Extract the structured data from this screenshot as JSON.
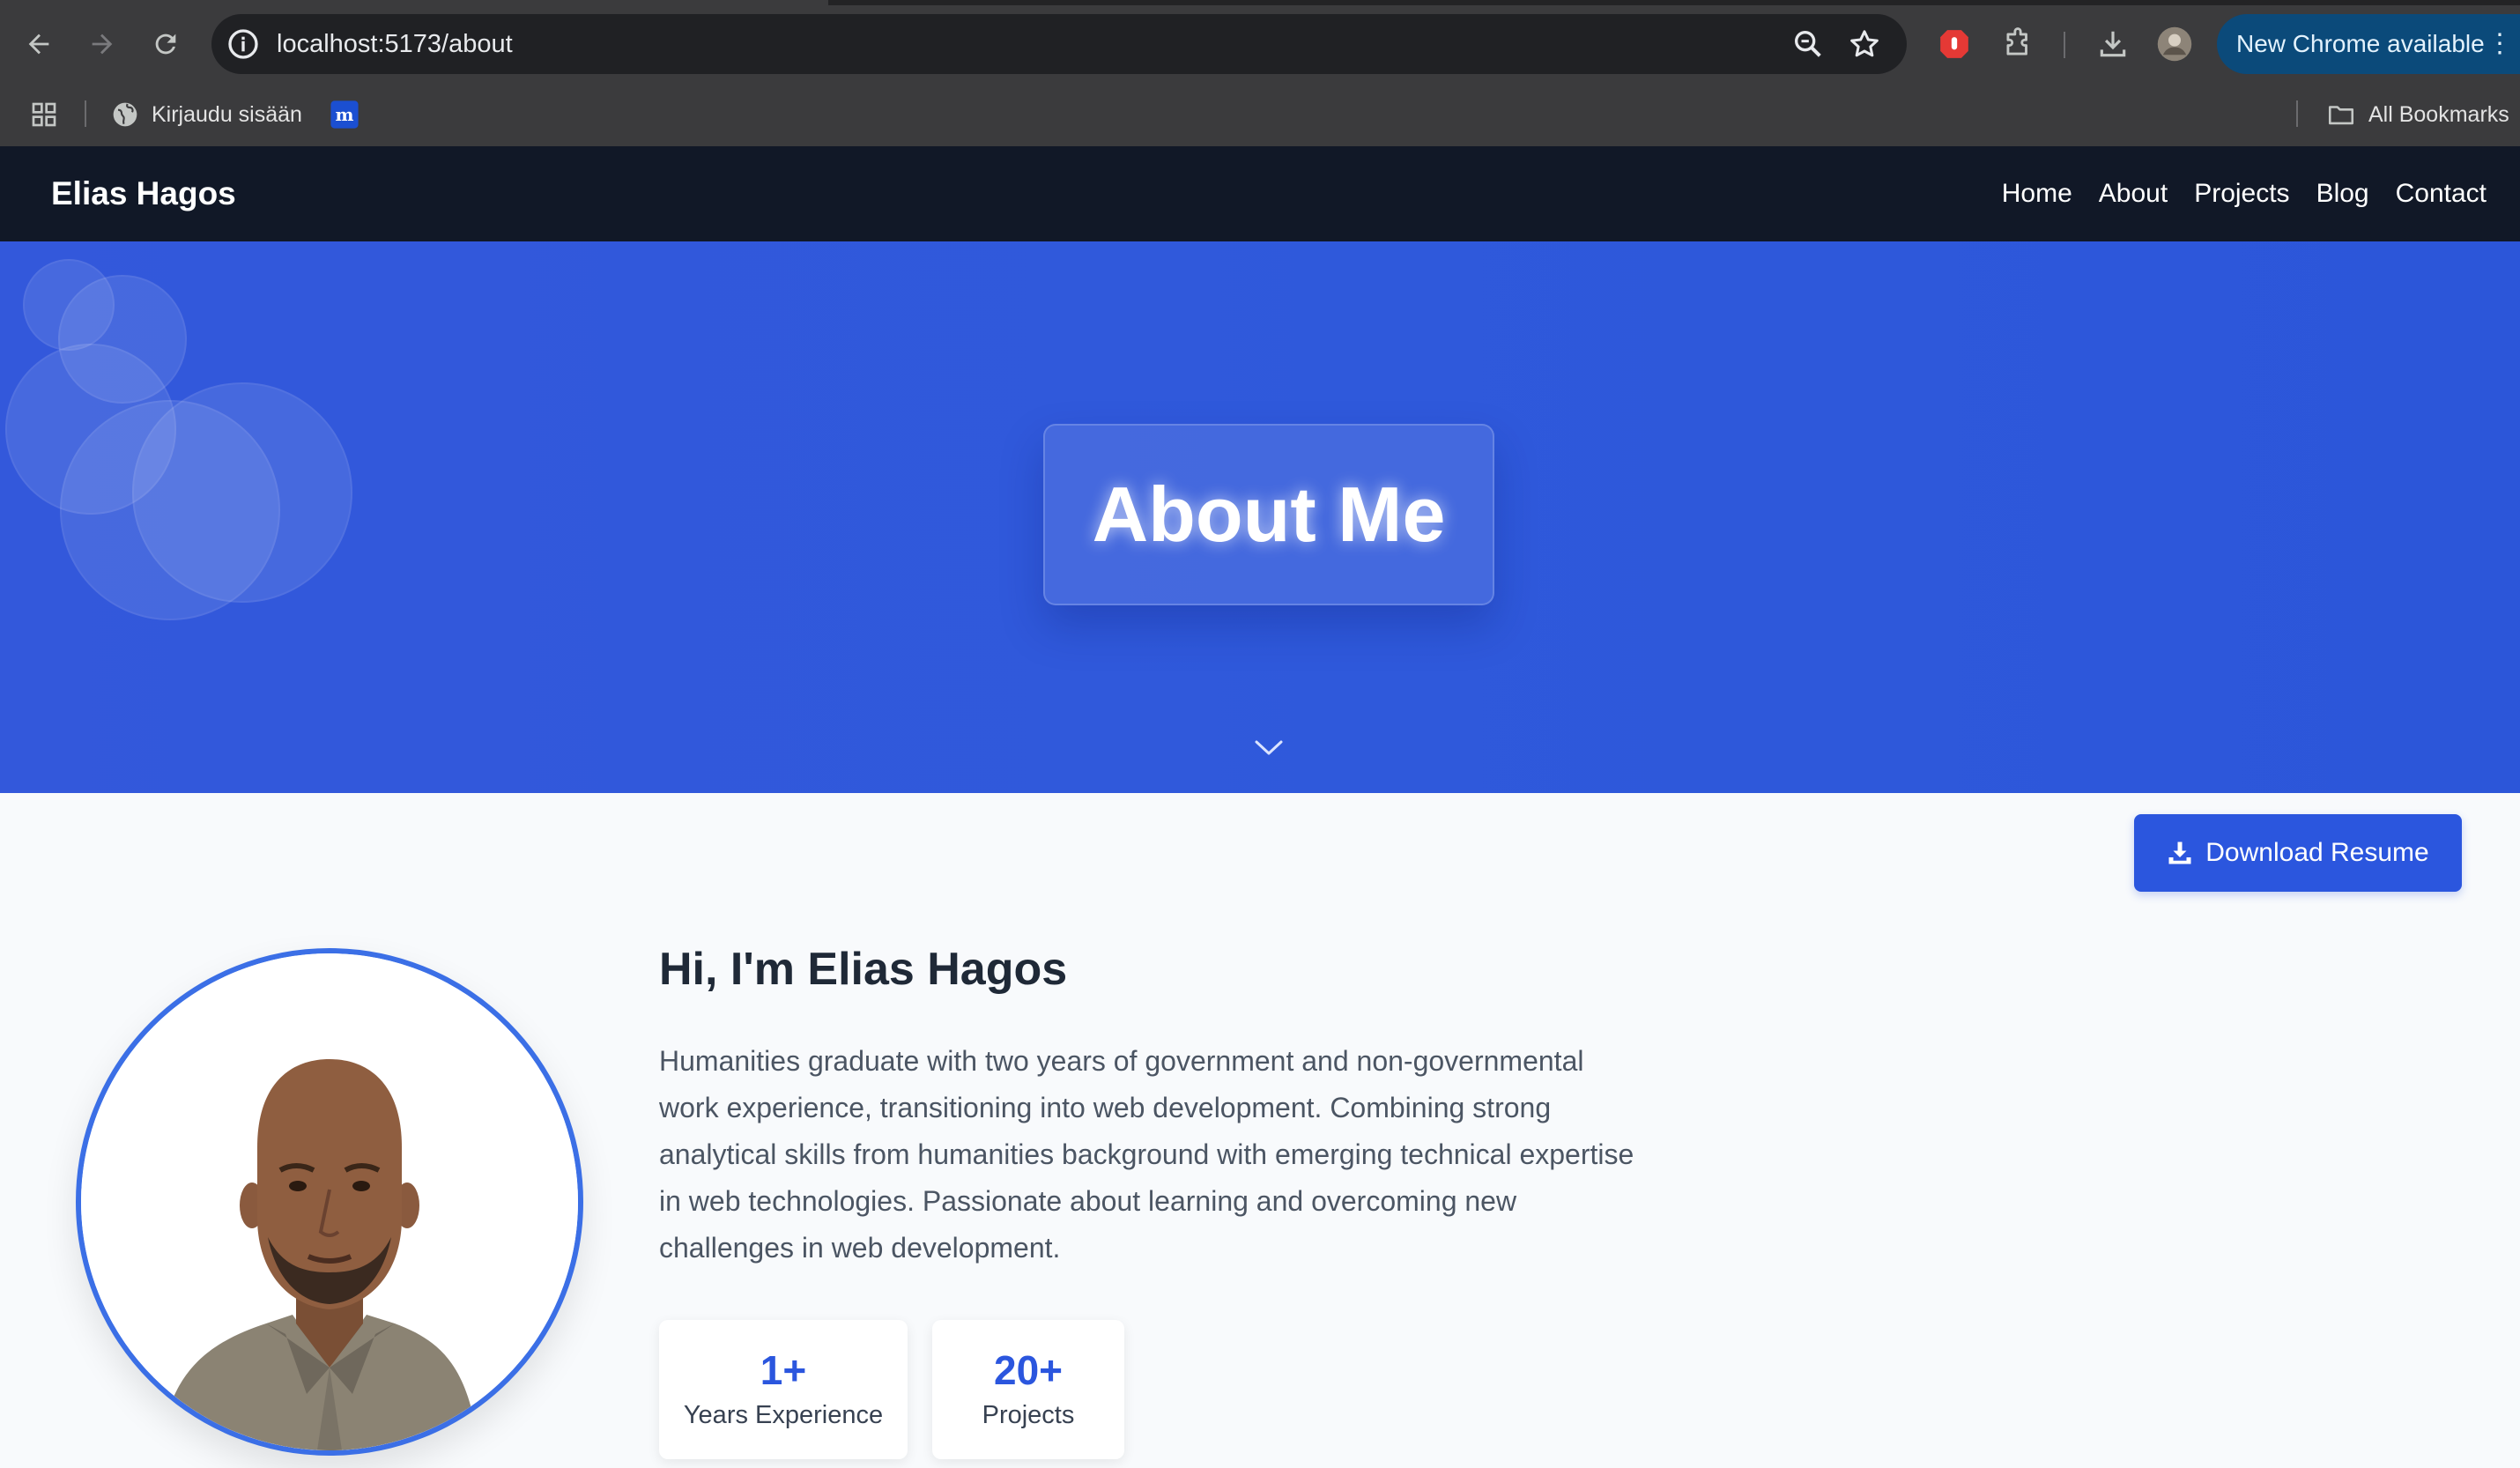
{
  "browser": {
    "url": "localhost:5173/about",
    "update_label": "New Chrome available",
    "bookmarks": [
      {
        "label": "Kirjaudu sisään",
        "icon": "globe-icon"
      },
      {
        "label": "",
        "icon": "m-logo-icon"
      }
    ],
    "all_bookmarks_label": "All Bookmarks"
  },
  "site": {
    "brand": "Elias Hagos",
    "nav": [
      "Home",
      "About",
      "Projects",
      "Blog",
      "Contact"
    ]
  },
  "hero": {
    "title": "About Me"
  },
  "about": {
    "download_label": "Download Resume",
    "greeting": "Hi, I'm Elias Hagos",
    "bio": "Humanities graduate with two years of government and non-governmental work experience, transitioning into web development. Combining strong analytical skills from humanities background with emerging technical expertise in web technologies. Passionate about learning and overcoming new challenges in web development.",
    "stats": [
      {
        "value": "1+",
        "label": "Years Experience"
      },
      {
        "value": "20+",
        "label": "Projects"
      }
    ]
  },
  "colors": {
    "nav_bg": "#111827",
    "hero_blue": "#2f59db",
    "accent": "#2b56de",
    "ring": "#3b6fe6"
  }
}
